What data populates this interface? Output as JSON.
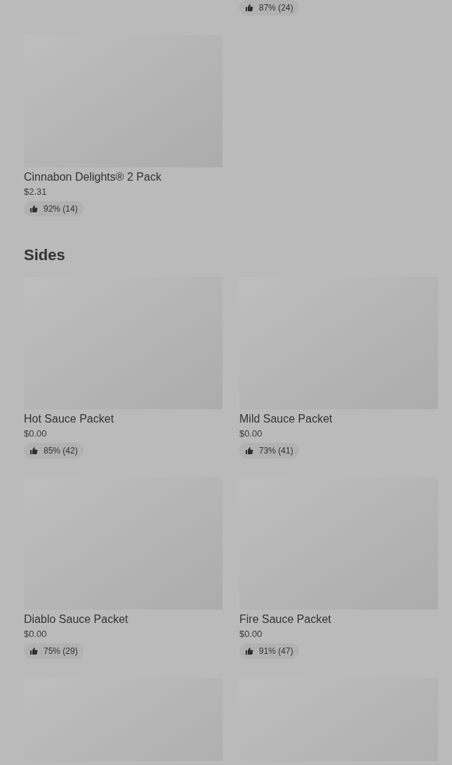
{
  "partial_card": {
    "rating": "87% (24)"
  },
  "first_section": {
    "items": [
      {
        "kind": "full",
        "name": "Cinnabon Delights® 2 Pack",
        "price": "$2.31",
        "rating": "92% (14)"
      }
    ]
  },
  "sides": {
    "title": "Sides",
    "items": [
      {
        "kind": "full",
        "name": "Hot Sauce Packet",
        "price": "$0.00",
        "rating": "85% (42)"
      },
      {
        "kind": "full",
        "name": "Mild Sauce Packet",
        "price": "$0.00",
        "rating": "73% (41)"
      },
      {
        "kind": "full",
        "name": "Diablo Sauce Packet",
        "price": "$0.00",
        "rating": "75% (29)"
      },
      {
        "kind": "full",
        "name": "Fire Sauce Packet",
        "price": "$0.00",
        "rating": "91% (47)"
      },
      {
        "kind": "image_only"
      },
      {
        "kind": "image_only"
      }
    ]
  }
}
